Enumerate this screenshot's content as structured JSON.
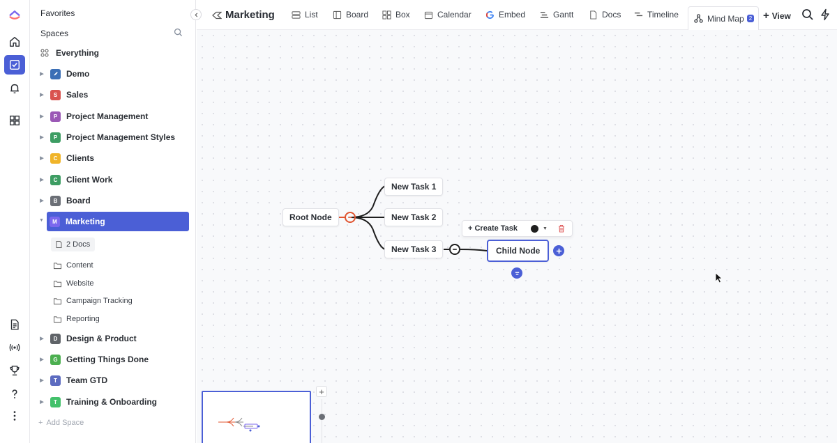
{
  "sidebar": {
    "favorites_label": "Favorites",
    "spaces_label": "Spaces",
    "everything_label": "Everything",
    "spaces": [
      {
        "letter": "",
        "label": "Demo",
        "color": "#3b6fb6"
      },
      {
        "letter": "S",
        "label": "Sales",
        "color": "#d9534f"
      },
      {
        "letter": "P",
        "label": "Project Management",
        "color": "#9b59b6"
      },
      {
        "letter": "P",
        "label": "Project Management Styles",
        "color": "#3d9d63"
      },
      {
        "letter": "C",
        "label": "Clients",
        "color": "#f0b429"
      },
      {
        "letter": "C",
        "label": "Client Work",
        "color": "#3d9d63"
      },
      {
        "letter": "B",
        "label": "Board",
        "color": "#6b6f76"
      },
      {
        "letter": "M",
        "label": "Marketing",
        "color": "#7b68ee"
      }
    ],
    "marketing_docs": "2 Docs",
    "marketing_folders": [
      "Content",
      "Website",
      "Campaign Tracking",
      "Reporting"
    ],
    "spaces_after": [
      {
        "letter": "D",
        "label": "Design & Product",
        "color": "#5f6368"
      },
      {
        "letter": "G",
        "label": "Getting Things Done",
        "color": "#4caf50"
      },
      {
        "letter": "T",
        "label": "Team GTD",
        "color": "#5c6bc0"
      },
      {
        "letter": "T",
        "label": "Training & Onboarding",
        "color": "#43c16b"
      }
    ],
    "add_space_label": "Add Space"
  },
  "topbar": {
    "title": "Marketing",
    "tabs": [
      "List",
      "Board",
      "Box",
      "Calendar",
      "Embed",
      "Gantt",
      "Docs",
      "Timeline",
      "Mind Map"
    ],
    "active_tab_count": "2",
    "add_view_label": "View"
  },
  "mindmap": {
    "root": "Root Node",
    "tasks": [
      "New Task 1",
      "New Task 2",
      "New Task 3"
    ],
    "child": "Child Node",
    "toolbar_create": "+ Create Task"
  },
  "colors": {
    "accent": "#4b5fd6",
    "root_collapse": "#e0542f",
    "trash": "#e06060"
  }
}
